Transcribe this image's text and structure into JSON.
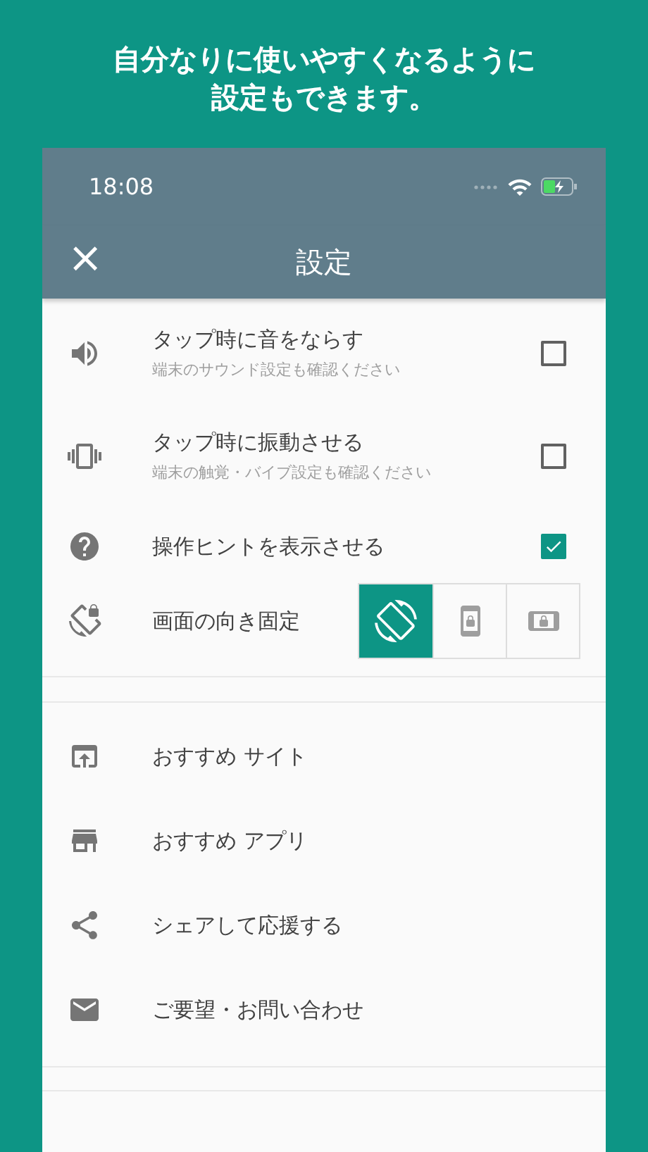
{
  "headline": [
    "自分なりに使いやすくなるように",
    "設定もできます。"
  ],
  "status_bar": {
    "time": "18:08",
    "battery_charging": true
  },
  "app_bar": {
    "title": "設定",
    "close": "×"
  },
  "settings": [
    {
      "kind": "checkbox",
      "label": "タップ時に音をならす",
      "sublabel": "端末のサウンド設定も確認ください",
      "checked": false
    },
    {
      "kind": "checkbox",
      "label": "タップ時に振動させる",
      "sublabel": "端末の触覚・バイブ設定も確認ください",
      "checked": false
    },
    {
      "kind": "checkbox",
      "label": "操作ヒントを表示させる",
      "checked": true
    },
    {
      "kind": "segmented",
      "label": "画面の向き固定",
      "options": [
        {
          "selected": true
        },
        {
          "selected": false
        },
        {
          "selected": false
        }
      ]
    }
  ],
  "links": [
    {
      "label": "おすすめ サイト"
    },
    {
      "label": "おすすめ アプリ"
    },
    {
      "label": "シェアして応援する"
    },
    {
      "label": "ご要望・お問い合わせ"
    }
  ]
}
